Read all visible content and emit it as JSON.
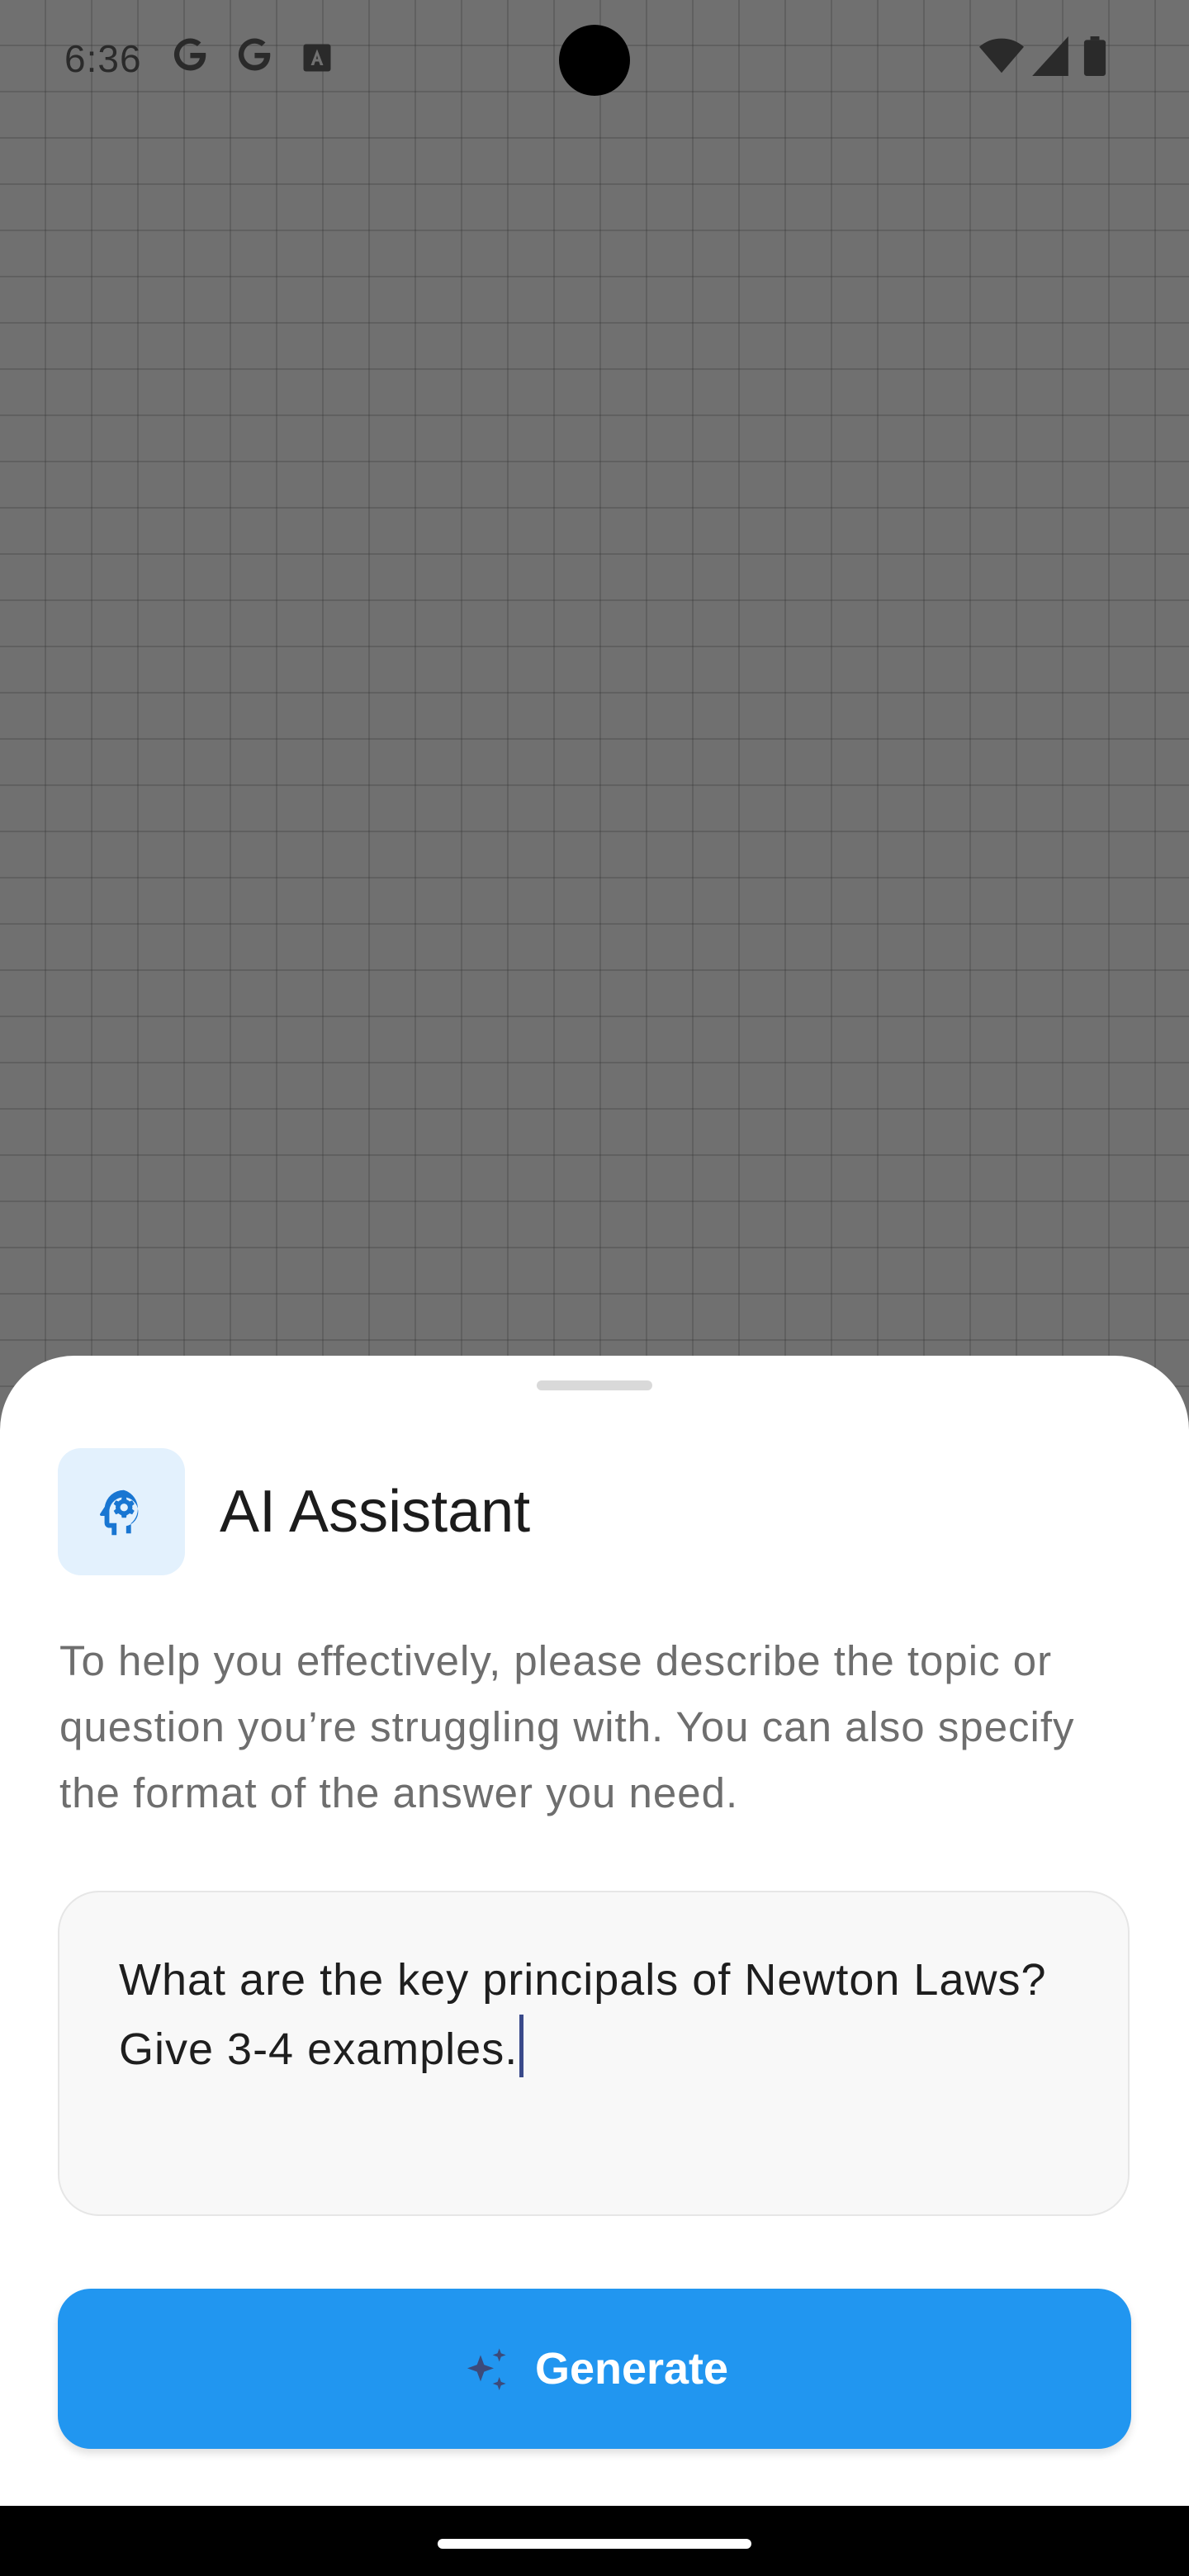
{
  "status_bar": {
    "time": "6:36",
    "notification_icons": [
      "google-icon",
      "google-icon",
      "text-a-icon"
    ],
    "system_icons": [
      "wifi-icon",
      "cellular-signal-icon",
      "battery-icon"
    ]
  },
  "sheet": {
    "title": "AI Assistant",
    "header_icon": "ai-brain-icon",
    "description": "To help you effectively, please describe the topic or question you’re struggling with. You can also specify the format of the answer you need.",
    "prompt": {
      "value": "What are the key principals of Newton Laws? Give 3-4 examples."
    },
    "generate_button": {
      "label": "Generate",
      "icon": "sparkle-icon"
    }
  },
  "colors": {
    "accent": "#2196f0",
    "icon_bg": "#e3f1fd",
    "icon_color": "#1976d2"
  }
}
